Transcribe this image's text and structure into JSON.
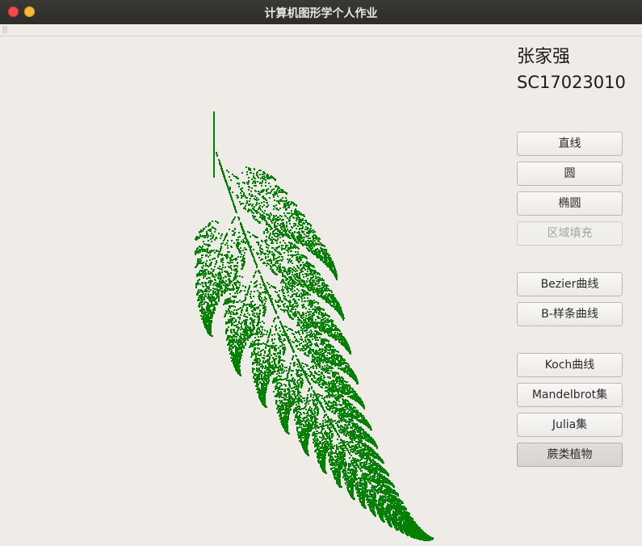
{
  "window": {
    "title": "计算机图形学个人作业"
  },
  "sidebar": {
    "name": "张家强",
    "student_id": "SC17023010",
    "buttons": [
      {
        "label": "直线",
        "state": "normal"
      },
      {
        "label": "圆",
        "state": "normal"
      },
      {
        "label": "椭圆",
        "state": "normal"
      },
      {
        "label": "区域填充",
        "state": "disabled"
      },
      {
        "label": "Bezier曲线",
        "state": "normal"
      },
      {
        "label": "B-样条曲线",
        "state": "normal"
      },
      {
        "label": "Koch曲线",
        "state": "normal"
      },
      {
        "label": "Mandelbrot集",
        "state": "normal"
      },
      {
        "label": "Julia集",
        "state": "normal"
      },
      {
        "label": "蕨类植物",
        "state": "active"
      }
    ]
  },
  "canvas": {
    "fern_color": "#008000"
  },
  "colors": {
    "background": "#efebe7",
    "titlebar": "#2d2c29",
    "close": "#ef4c4c",
    "minimize": "#f8b83a"
  }
}
